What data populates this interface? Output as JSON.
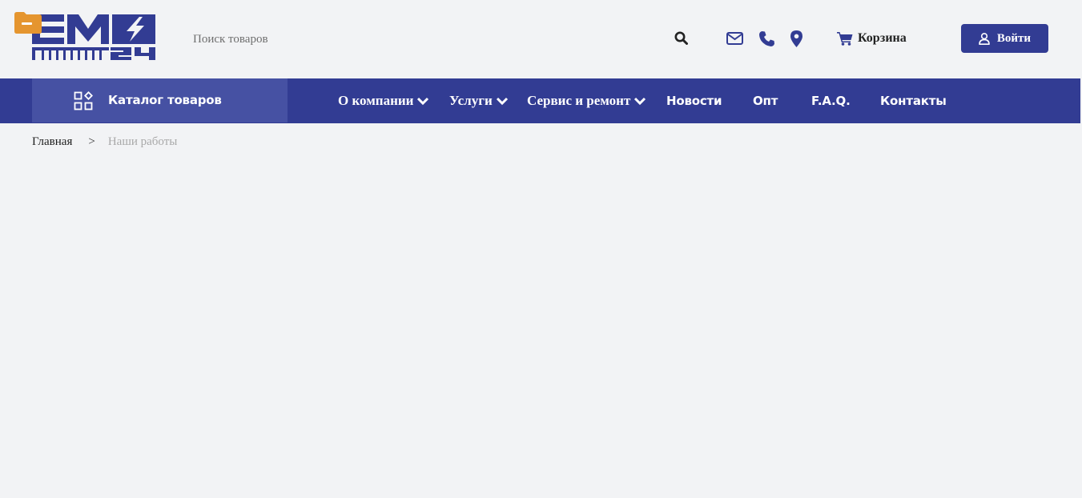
{
  "header": {
    "logo_alt": "ЕМ24",
    "search": {
      "placeholder": "Поиск товаров",
      "value": ""
    },
    "icons": [
      "search-icon",
      "envelope-icon",
      "phone-icon",
      "map-marker-icon",
      "cart-icon",
      "user-icon",
      "folder-icon"
    ],
    "cart_label": "Корзина",
    "login_label": "Войти"
  },
  "nav": {
    "catalog_label": "Каталог товаров",
    "items": [
      {
        "label": "О компании",
        "dropdown": true
      },
      {
        "label": "Услуги",
        "dropdown": true
      },
      {
        "label": "Сервис и ремонт",
        "dropdown": true
      },
      {
        "label": "Новости",
        "dropdown": false
      },
      {
        "label": "Опт",
        "dropdown": false
      },
      {
        "label": "F.A.Q.",
        "dropdown": false
      },
      {
        "label": "Контакты",
        "dropdown": false
      }
    ]
  },
  "breadcrumb": {
    "home": "Главная",
    "separator": ">",
    "current": "Наши работы"
  },
  "colors": {
    "brand": "#323c93",
    "catalog_bg": "#4651a3",
    "page_bg": "#f2f3f5",
    "badge": "#e5952f"
  }
}
